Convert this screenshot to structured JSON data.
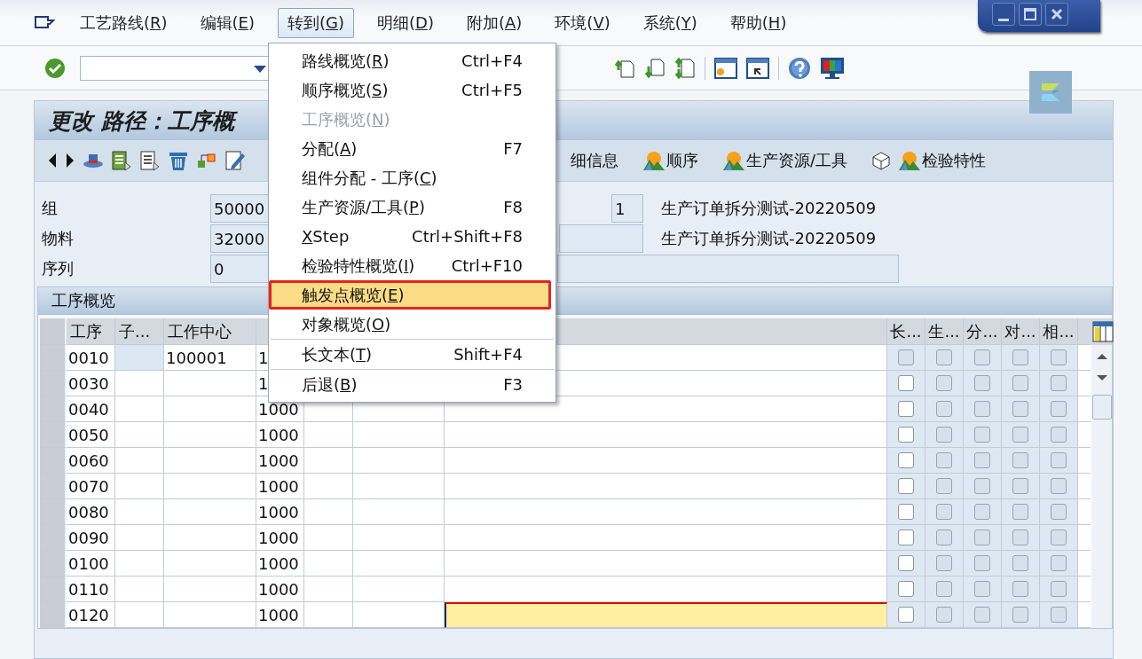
{
  "menu_bar": [
    {
      "before": "工艺路线(",
      "mnemonic": "R",
      "after": ")",
      "selected": false
    },
    {
      "before": "编辑(",
      "mnemonic": "E",
      "after": ")",
      "selected": false
    },
    {
      "before": "转到(",
      "mnemonic": "G",
      "after": ")",
      "selected": true
    },
    {
      "before": "明细(",
      "mnemonic": "D",
      "after": ")",
      "selected": false
    },
    {
      "before": "附加(",
      "mnemonic": "A",
      "after": ")",
      "selected": false
    },
    {
      "before": "环境(",
      "mnemonic": "V",
      "after": ")",
      "selected": false
    },
    {
      "before": "系统(",
      "mnemonic": "Y",
      "after": ")",
      "selected": false
    },
    {
      "before": "帮助(",
      "mnemonic": "H",
      "after": ")",
      "selected": false
    }
  ],
  "dropdown": [
    {
      "kind": "item",
      "before": "路线概览(",
      "mnemonic": "R",
      "after": ")",
      "shortcut": "Ctrl+F4",
      "disabled": false,
      "selected": false
    },
    {
      "kind": "item",
      "before": "顺序概览(",
      "mnemonic": "S",
      "after": ")",
      "shortcut": "Ctrl+F5",
      "disabled": false,
      "selected": false
    },
    {
      "kind": "item",
      "before": "工序概览(",
      "mnemonic": "N",
      "after": ")",
      "disabled": true,
      "selected": false
    },
    {
      "kind": "item",
      "before": "分配(",
      "mnemonic": "A",
      "after": ")",
      "shortcut": "F7",
      "disabled": false,
      "selected": false
    },
    {
      "kind": "item",
      "before": "组件分配 - 工序(",
      "mnemonic": "C",
      "after": ")",
      "disabled": false,
      "selected": false
    },
    {
      "kind": "item",
      "before": "生产资源/工具(",
      "mnemonic": "P",
      "after": ")",
      "shortcut": "F8",
      "disabled": false,
      "selected": false
    },
    {
      "kind": "item",
      "mnemonic": "X",
      "after": "Step",
      "shortcut": "Ctrl+Shift+F8",
      "disabled": false,
      "selected": false
    },
    {
      "kind": "item",
      "before": "检验特性概览(",
      "mnemonic": "I",
      "after": ")",
      "shortcut": "Ctrl+F10",
      "disabled": false,
      "selected": false
    },
    {
      "kind": "item",
      "before": "触发点概览(",
      "mnemonic": "E",
      "after": ")",
      "disabled": false,
      "selected": true
    },
    {
      "kind": "item",
      "before": "对象概览(",
      "mnemonic": "O",
      "after": ")",
      "disabled": false,
      "selected": false
    },
    {
      "kind": "separator"
    },
    {
      "kind": "item",
      "before": "长文本(",
      "mnemonic": "T",
      "after": ")",
      "shortcut": "Shift+F4",
      "disabled": false,
      "selected": false
    },
    {
      "kind": "separator"
    },
    {
      "kind": "item",
      "before": "后退(",
      "mnemonic": "B",
      "after": ")",
      "shortcut": "F3",
      "disabled": false,
      "selected": false
    }
  ],
  "title": "更改 路径：工序概",
  "app_toolbar": [
    "细信息",
    "顺序",
    "生产资源/工具",
    "检验特性"
  ],
  "header": {
    "group": {
      "label": "组",
      "value": "50000",
      "counter": "1",
      "description": "生产订单拆分测试-20220509"
    },
    "material": {
      "label": "物料",
      "value": "32000",
      "description": "生产订单拆分测试-20220509"
    },
    "sequence": {
      "label": "序列",
      "value": "0"
    }
  },
  "table": {
    "title": "工序概览",
    "columns": [
      "工序",
      "子...",
      "工作中心"
    ],
    "check_columns": [
      "长...",
      "生...",
      "分...",
      "对...",
      "相..."
    ],
    "rows": [
      {
        "operation": "0010",
        "work_center": "100001",
        "plant": "1",
        "shaded": true,
        "editing": false,
        "checks": [
          {
            "checked": false,
            "disabled": true
          },
          {
            "checked": false,
            "disabled": true
          },
          {
            "checked": false,
            "disabled": true
          },
          {
            "checked": false,
            "disabled": true
          },
          {
            "checked": false,
            "disabled": true
          }
        ]
      },
      {
        "operation": "0030",
        "plant": "1",
        "shaded": false,
        "editing": false,
        "checks": [
          {
            "checked": false,
            "disabled": false
          },
          {
            "checked": false,
            "disabled": true
          },
          {
            "checked": false,
            "disabled": true
          },
          {
            "checked": false,
            "disabled": true
          },
          {
            "checked": false,
            "disabled": true
          }
        ]
      },
      {
        "operation": "0040",
        "plant": "1000",
        "shaded": false,
        "editing": false,
        "checks": [
          {
            "checked": false,
            "disabled": false
          },
          {
            "checked": false,
            "disabled": true
          },
          {
            "checked": false,
            "disabled": true
          },
          {
            "checked": false,
            "disabled": true
          },
          {
            "checked": false,
            "disabled": true
          }
        ]
      },
      {
        "operation": "0050",
        "plant": "1000",
        "shaded": false,
        "editing": false,
        "checks": [
          {
            "checked": false,
            "disabled": false
          },
          {
            "checked": false,
            "disabled": true
          },
          {
            "checked": false,
            "disabled": true
          },
          {
            "checked": false,
            "disabled": true
          },
          {
            "checked": false,
            "disabled": true
          }
        ]
      },
      {
        "operation": "0060",
        "plant": "1000",
        "shaded": false,
        "editing": false,
        "checks": [
          {
            "checked": false,
            "disabled": false
          },
          {
            "checked": false,
            "disabled": true
          },
          {
            "checked": false,
            "disabled": true
          },
          {
            "checked": false,
            "disabled": true
          },
          {
            "checked": false,
            "disabled": true
          }
        ]
      },
      {
        "operation": "0070",
        "plant": "1000",
        "shaded": false,
        "editing": false,
        "checks": [
          {
            "checked": false,
            "disabled": false
          },
          {
            "checked": false,
            "disabled": true
          },
          {
            "checked": false,
            "disabled": true
          },
          {
            "checked": false,
            "disabled": true
          },
          {
            "checked": false,
            "disabled": true
          }
        ]
      },
      {
        "operation": "0080",
        "plant": "1000",
        "shaded": false,
        "editing": false,
        "checks": [
          {
            "checked": false,
            "disabled": false
          },
          {
            "checked": false,
            "disabled": true
          },
          {
            "checked": false,
            "disabled": true
          },
          {
            "checked": false,
            "disabled": true
          },
          {
            "checked": false,
            "disabled": true
          }
        ]
      },
      {
        "operation": "0090",
        "plant": "1000",
        "shaded": false,
        "editing": false,
        "checks": [
          {
            "checked": false,
            "disabled": false
          },
          {
            "checked": false,
            "disabled": true
          },
          {
            "checked": false,
            "disabled": true
          },
          {
            "checked": false,
            "disabled": true
          },
          {
            "checked": false,
            "disabled": true
          }
        ]
      },
      {
        "operation": "0100",
        "plant": "1000",
        "shaded": false,
        "editing": false,
        "checks": [
          {
            "checked": false,
            "disabled": false
          },
          {
            "checked": false,
            "disabled": true
          },
          {
            "checked": false,
            "disabled": true
          },
          {
            "checked": false,
            "disabled": true
          },
          {
            "checked": false,
            "disabled": true
          }
        ]
      },
      {
        "operation": "0110",
        "plant": "1000",
        "shaded": false,
        "editing": false,
        "checks": [
          {
            "checked": false,
            "disabled": false
          },
          {
            "checked": false,
            "disabled": true
          },
          {
            "checked": false,
            "disabled": true
          },
          {
            "checked": false,
            "disabled": true
          },
          {
            "checked": false,
            "disabled": true
          }
        ]
      },
      {
        "operation": "0120",
        "plant": "1000",
        "shaded": false,
        "editing": true,
        "checks": [
          {
            "checked": false,
            "disabled": false
          },
          {
            "checked": false,
            "disabled": true
          },
          {
            "checked": false,
            "disabled": true
          },
          {
            "checked": false,
            "disabled": true
          },
          {
            "checked": false,
            "disabled": true
          }
        ]
      }
    ]
  }
}
